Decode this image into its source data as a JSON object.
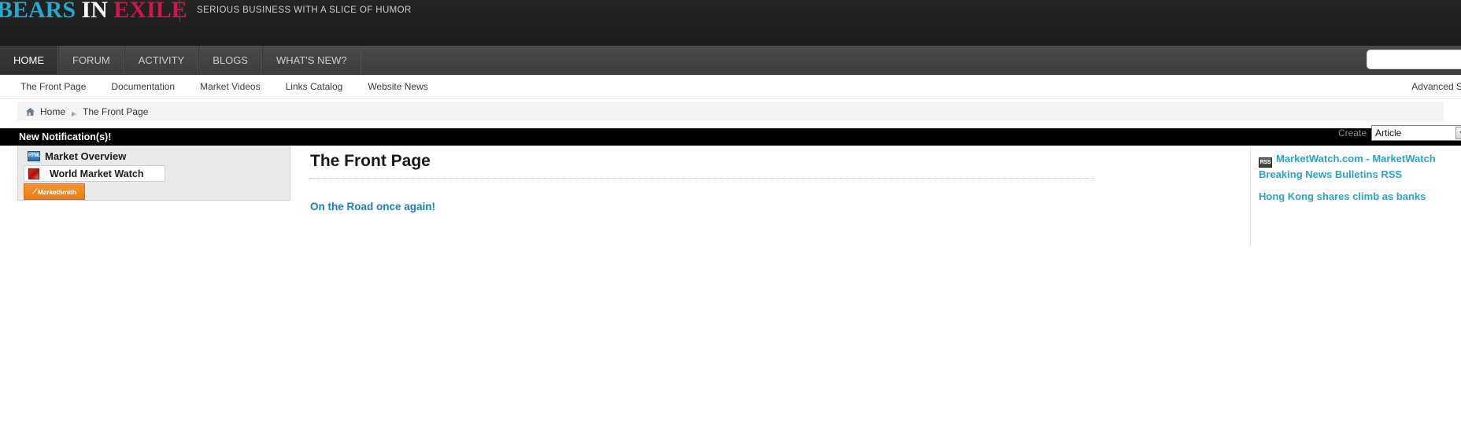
{
  "header": {
    "logo": {
      "word1": "BEARS",
      "word2": "IN",
      "word3": "EXILE"
    },
    "tagline": "SERIOUS BUSINESS WITH A SLICE OF HUMOR"
  },
  "nav": {
    "items": [
      {
        "label": "HOME",
        "active": true
      },
      {
        "label": "FORUM",
        "active": false
      },
      {
        "label": "ACTIVITY",
        "active": false
      },
      {
        "label": "BLOGS",
        "active": false
      },
      {
        "label": "WHAT'S NEW?",
        "active": false
      }
    ],
    "search_placeholder": "",
    "search_value": ""
  },
  "subnav": {
    "items": [
      {
        "label": "The Front Page"
      },
      {
        "label": "Documentation"
      },
      {
        "label": "Market Videos"
      },
      {
        "label": "Links Catalog"
      },
      {
        "label": "Website News"
      }
    ],
    "advanced_search": "Advanced Search"
  },
  "breadcrumb": {
    "home": "Home",
    "current": "The Front Page"
  },
  "notification": {
    "text": "New Notification(s)!",
    "create_label": "Create",
    "create_value": "Article",
    "create_options": [
      "Article"
    ]
  },
  "sidebar": {
    "module_title": "Market Overview",
    "module_icon_label": "HTML",
    "items": [
      {
        "label": "World Market Watch"
      }
    ],
    "badge": {
      "label": "MarketSmith",
      "tick": "⟋"
    }
  },
  "main": {
    "page_title": "The Front Page",
    "articles": [
      {
        "title": "On the Road once again!"
      }
    ]
  },
  "right": {
    "feed_icon_label": "RSS",
    "feed_title": "MarketWatch.com - MarketWatch Breaking News Bulletins  RSS",
    "items": [
      {
        "label": "Hong Kong shares climb as banks"
      }
    ]
  }
}
